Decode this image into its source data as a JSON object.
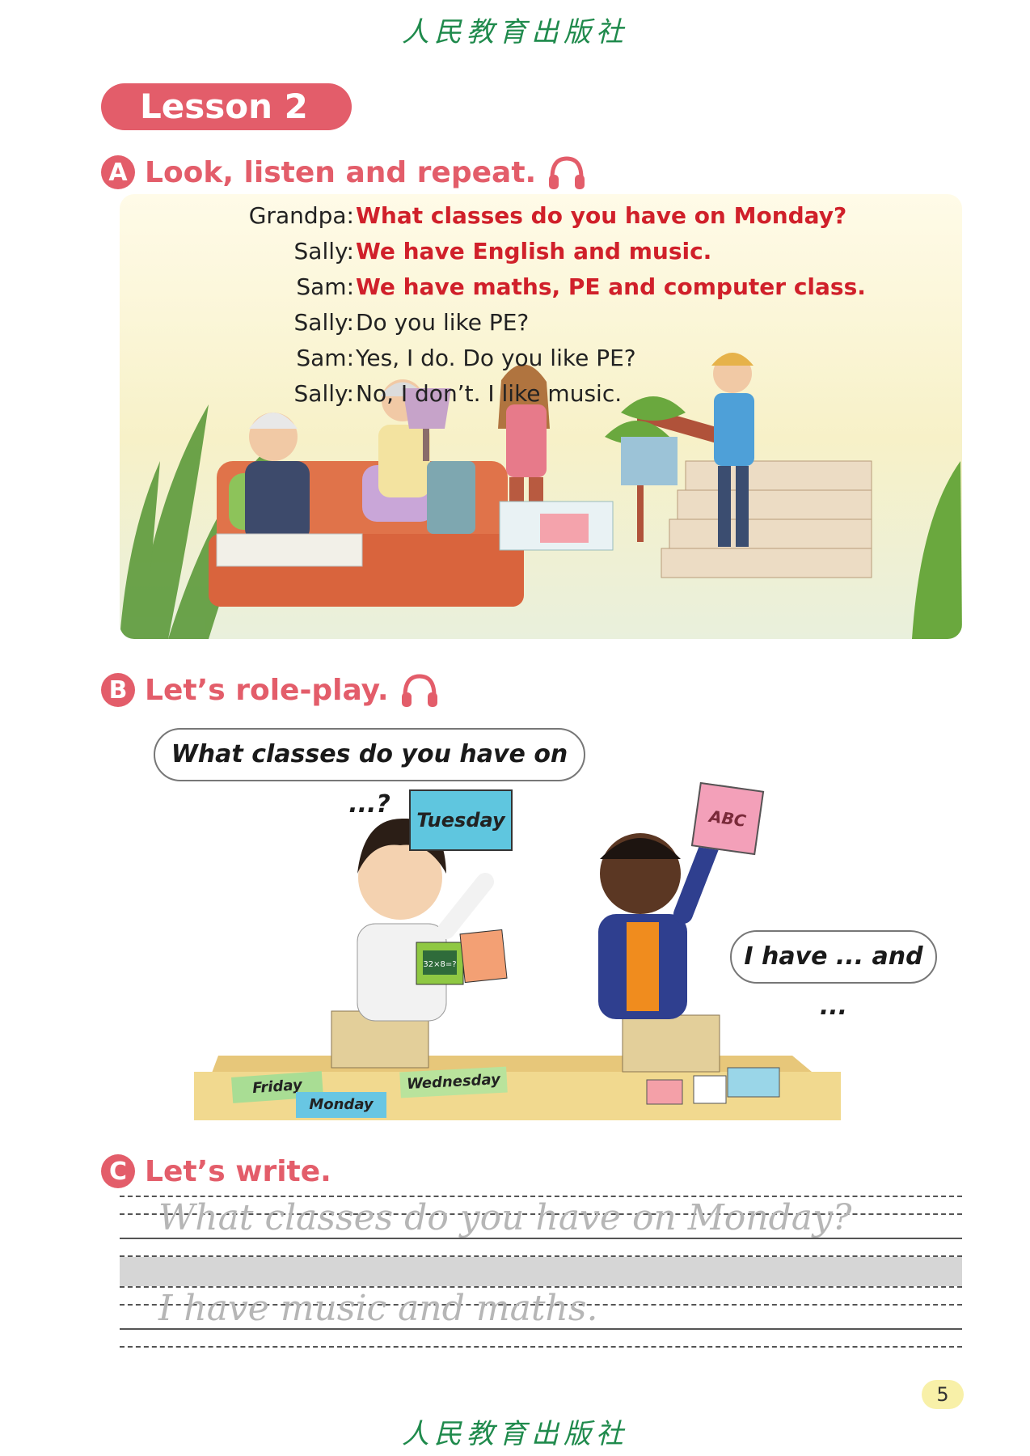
{
  "publisher": "人民教育出版社",
  "lesson": {
    "title": "Lesson 2"
  },
  "section_a": {
    "badge": "A",
    "title": "Look, listen and repeat.",
    "icon": "headphone-icon",
    "dialogue": [
      {
        "speaker": "Grandpa:",
        "text": "What classes do you have on Monday?",
        "highlight": true
      },
      {
        "speaker": "Sally:",
        "text": "We have English and music.",
        "highlight": true
      },
      {
        "speaker": "Sam:",
        "text": "We have maths, PE and computer class.",
        "highlight": true
      },
      {
        "speaker": "Sally:",
        "text": "Do you like PE?",
        "highlight": false
      },
      {
        "speaker": "Sam:",
        "text": "Yes, I do. Do you like PE?",
        "highlight": false
      },
      {
        "speaker": "Sally:",
        "text": "No, I don’t. I like music.",
        "highlight": false
      }
    ]
  },
  "section_b": {
    "badge": "B",
    "title": "Let’s role-play.",
    "icon": "headphone-icon",
    "bubble_question": "What classes do you have on ...?",
    "bubble_answer": "I have ... and ...",
    "cards": {
      "tuesday": "Tuesday",
      "abc": "ABC",
      "friday": "Friday",
      "monday": "Monday",
      "wednesday": "Wednesday",
      "math": "32×8=?"
    }
  },
  "section_c": {
    "badge": "C",
    "title": "Let’s write.",
    "trace_line_1": "What classes do you have on Monday?",
    "trace_line_2": "I have music and maths."
  },
  "page_number": "5",
  "colors": {
    "accent": "#e35d6a",
    "highlight_text": "#d0202a",
    "publisher_green": "#1f8a4c"
  }
}
